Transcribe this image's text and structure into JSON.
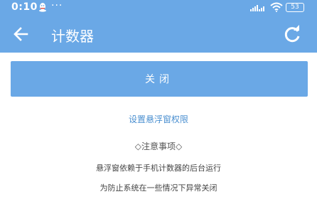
{
  "colors": {
    "accent": "#6aa8e6",
    "link": "#4a8fd0",
    "text": "#444444"
  },
  "status_bar": {
    "time": "0:10",
    "dots": "···",
    "battery": "53",
    "icons": [
      "qq-icon",
      "signal-icon",
      "wifi-icon",
      "battery-icon"
    ]
  },
  "toolbar": {
    "title": "计数器",
    "back_icon": "arrow-left-icon",
    "refresh_icon": "refresh-icon"
  },
  "main": {
    "close_button_label": "关闭",
    "float_permission_link": "设置悬浮窗权限",
    "notice_title": "◇注意事项◇",
    "notice_lines": [
      "悬浮窗依赖于手机计数器的后台运行",
      "为防止系统在一些情况下异常关闭"
    ]
  }
}
